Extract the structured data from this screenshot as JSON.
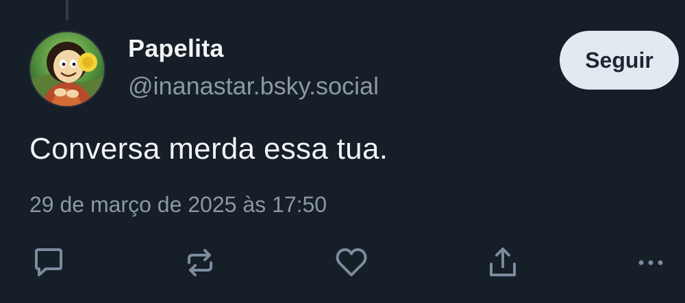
{
  "post": {
    "display_name": "Papelita",
    "handle": "@inanastar.bsky.social",
    "text": "Conversa merda essa tua.",
    "timestamp": "29 de março de 2025 às 17:50"
  },
  "follow_label": "Seguir",
  "actions": [
    {
      "icon": "reply-icon"
    },
    {
      "icon": "repost-icon"
    },
    {
      "icon": "like-icon"
    },
    {
      "icon": "share-icon"
    },
    {
      "icon": "more-options-icon"
    }
  ],
  "colors": {
    "background": "#161e27",
    "primary_text": "#f1f3f5",
    "secondary_text": "#8b98a5",
    "follow_button_bg": "#e3e9f0",
    "icon_color": "#7b8c9e"
  }
}
